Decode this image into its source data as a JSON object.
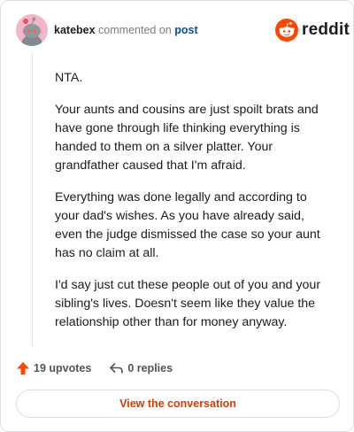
{
  "comment": {
    "username": "katebex",
    "action": "commented on",
    "post_link": "post",
    "paragraphs": [
      "NTA.",
      "Your aunts and cousins are just spoilt brats and have gone through life thinking everything is handed to them on a silver platter. Your grandfather caused that I'm afraid.",
      "Everything was done legally and according to your dad's wishes. As you have already said, even the judge dismissed the case so your aunt has no claim at all.",
      "I'd say just cut these people out of you and your sibling's lives. Doesn't seem like they value the relationship other than for money anyway."
    ]
  },
  "brand": {
    "name": "reddit",
    "color": "#ff4500"
  },
  "footer": {
    "upvotes": "19 upvotes",
    "replies": "0 replies",
    "upvote_color": "#ff4500"
  },
  "cta": {
    "label": "View the conversation",
    "color": "#d93a00"
  },
  "icons": [
    "avatar",
    "reddit-logo-icon",
    "upvote-arrow-icon",
    "reply-arrow-icon"
  ]
}
